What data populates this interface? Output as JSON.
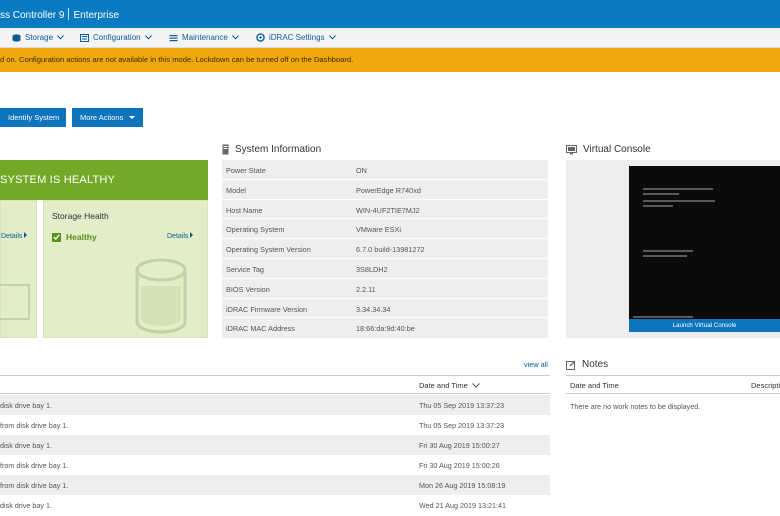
{
  "header": {
    "title": "ss Controller 9",
    "edition": "Enterprise"
  },
  "nav": {
    "items": [
      {
        "label": "Storage",
        "icon": "storage-icon"
      },
      {
        "label": "Configuration",
        "icon": "configuration-icon"
      },
      {
        "label": "Maintenance",
        "icon": "maintenance-icon"
      },
      {
        "label": "iDRAC Settings",
        "icon": "idrac-settings-icon"
      }
    ]
  },
  "banner": {
    "text": "d on. Configuration actions are not available in this mode. Lockdown can be turned off on the Dashboard."
  },
  "actions": {
    "identify": "Identify System",
    "more": "More Actions"
  },
  "health": {
    "status": "SYSTEM IS HEALTHY",
    "details_left": "Details",
    "storage_title": "Storage Health",
    "storage_status": "Healthy",
    "storage_details": "Details"
  },
  "system_info": {
    "title": "System Information",
    "rows": [
      {
        "k": "Power State",
        "v": "ON"
      },
      {
        "k": "Model",
        "v": "PowerEdge R740xd"
      },
      {
        "k": "Host Name",
        "v": "WIN-4UF2TIE7MJ2"
      },
      {
        "k": "Operating System",
        "v": "VMware ESXi"
      },
      {
        "k": "Operating System Version",
        "v": "6.7.0 build-13981272"
      },
      {
        "k": "Service Tag",
        "v": "3S8LDH2"
      },
      {
        "k": "BIOS Version",
        "v": "2.2.11"
      },
      {
        "k": "iDRAC Firmware Version",
        "v": "3.34.34.34"
      },
      {
        "k": "iDRAC MAC Address",
        "v": "18:66:da:9d:40:be"
      }
    ]
  },
  "virtual_console": {
    "title": "Virtual Console",
    "launch": "Launch Virtual Console"
  },
  "logs": {
    "view_all": "view all",
    "date_col": "Date and Time",
    "rows": [
      {
        "msg": "disk drive bay 1.",
        "date": "Thu 05 Sep 2019 13:37:23"
      },
      {
        "msg": "from disk drive bay 1.",
        "date": "Thu 05 Sep 2019 13:37:23"
      },
      {
        "msg": "disk drive bay 1.",
        "date": "Fri 30 Aug 2019 15:00:27"
      },
      {
        "msg": "from disk drive bay 1.",
        "date": "Fri 30 Aug 2019 15:00:26"
      },
      {
        "msg": "from disk drive bay 1.",
        "date": "Mon 26 Aug 2019 15:08:19"
      },
      {
        "msg": "disk drive bay 1.",
        "date": "Wed 21 Aug 2019 13:21:41"
      }
    ]
  },
  "notes": {
    "title": "Notes",
    "col_date": "Date and Time",
    "col_desc": "Descripti",
    "empty": "There are no work notes to be displayed."
  }
}
